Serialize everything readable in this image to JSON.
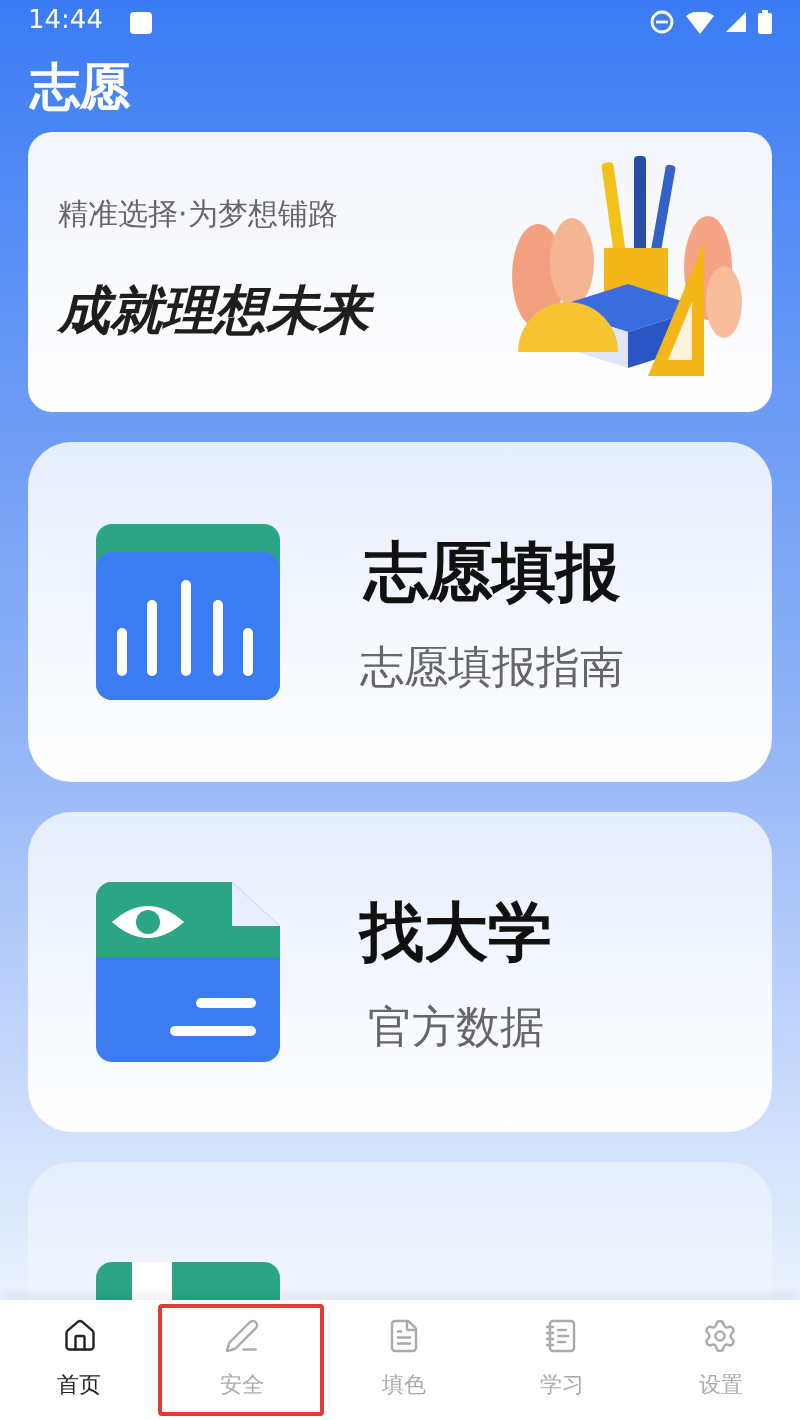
{
  "status_bar": {
    "time": "14:44"
  },
  "header": {
    "title": "志愿"
  },
  "banner": {
    "subtitle": "精准选择·为梦想铺路",
    "headline": "成就理想未来"
  },
  "cards": [
    {
      "kind": "chart",
      "title": "志愿填报",
      "subtitle": "志愿填报指南"
    },
    {
      "kind": "document",
      "title": "找大学",
      "subtitle": "官方数据"
    },
    {
      "kind": "book"
    }
  ],
  "tabs": [
    {
      "kind": "home",
      "label": "首页",
      "selected": true,
      "highlighted": false
    },
    {
      "kind": "pen",
      "label": "安全",
      "selected": false,
      "highlighted": true
    },
    {
      "kind": "list",
      "label": "填色",
      "selected": false,
      "highlighted": false
    },
    {
      "kind": "notebook",
      "label": "学习",
      "selected": false,
      "highlighted": false
    },
    {
      "kind": "gear",
      "label": "设置",
      "selected": false,
      "highlighted": false
    }
  ]
}
